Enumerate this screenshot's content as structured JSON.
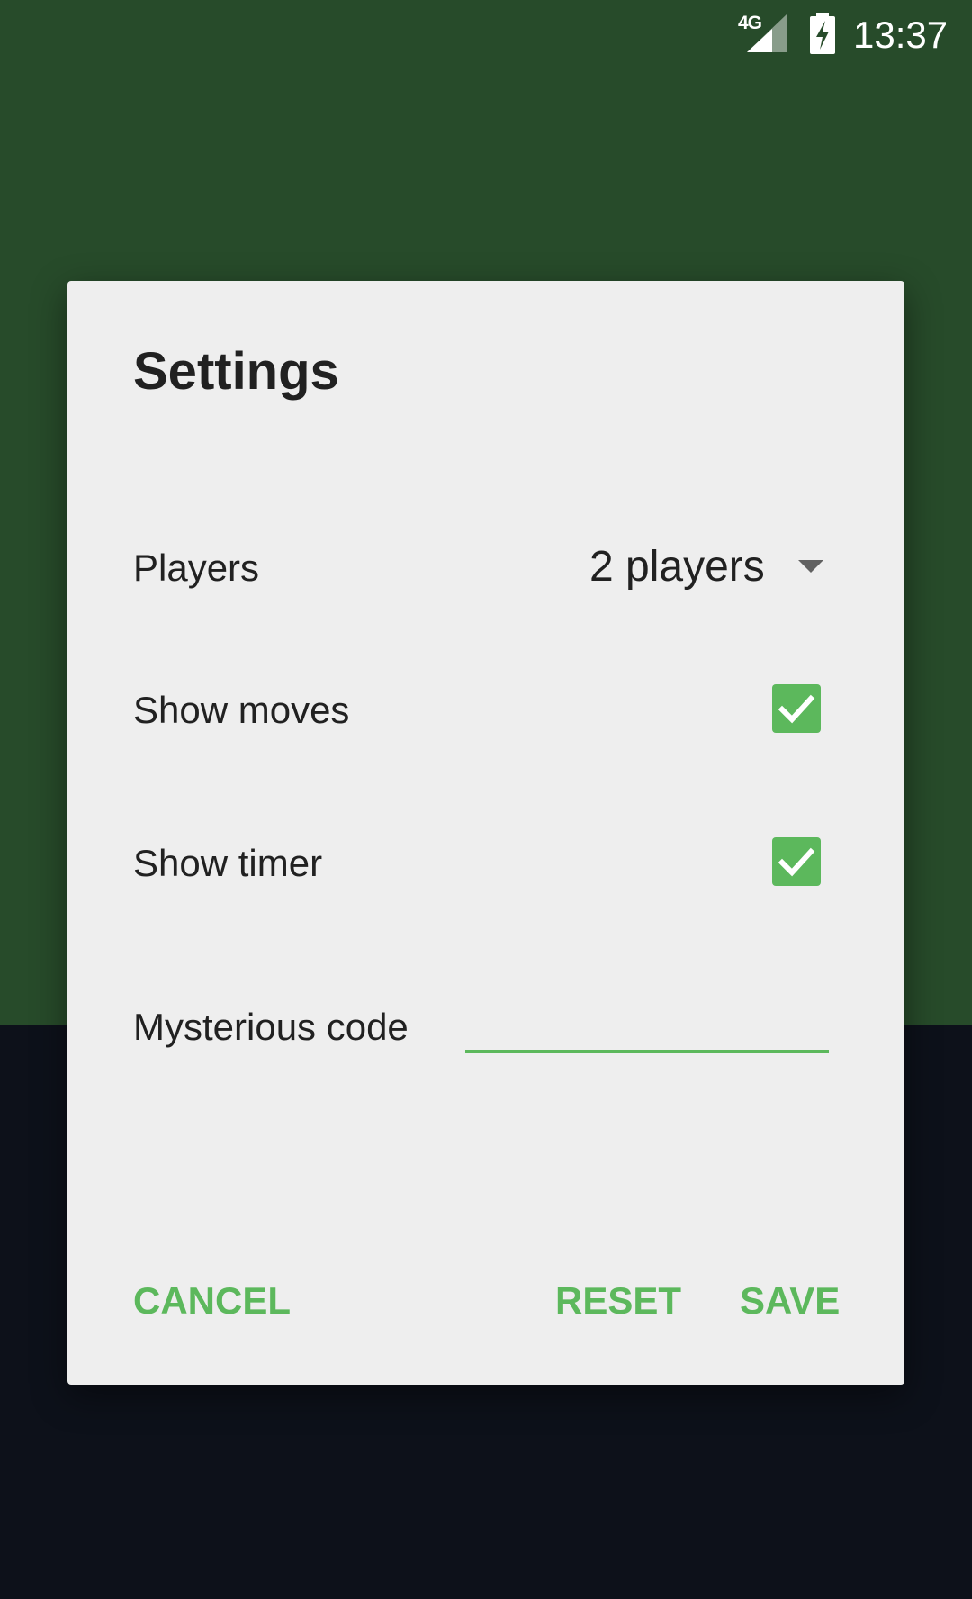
{
  "status_bar": {
    "network": "4G",
    "time": "13:37",
    "icons": [
      "signal-icon",
      "battery-charging-icon"
    ]
  },
  "dialog": {
    "title": "Settings",
    "players": {
      "label": "Players",
      "value": "2 players"
    },
    "show_moves": {
      "label": "Show moves",
      "checked": true
    },
    "show_timer": {
      "label": "Show timer",
      "checked": true
    },
    "code": {
      "label": "Mysterious code",
      "value": ""
    },
    "buttons": {
      "cancel": "CANCEL",
      "reset": "RESET",
      "save": "SAVE"
    }
  },
  "colors": {
    "background_top": "#274b2a",
    "background_bottom": "#0d111a",
    "dialog_background": "#eeeeee",
    "accent": "#5cb85c"
  }
}
